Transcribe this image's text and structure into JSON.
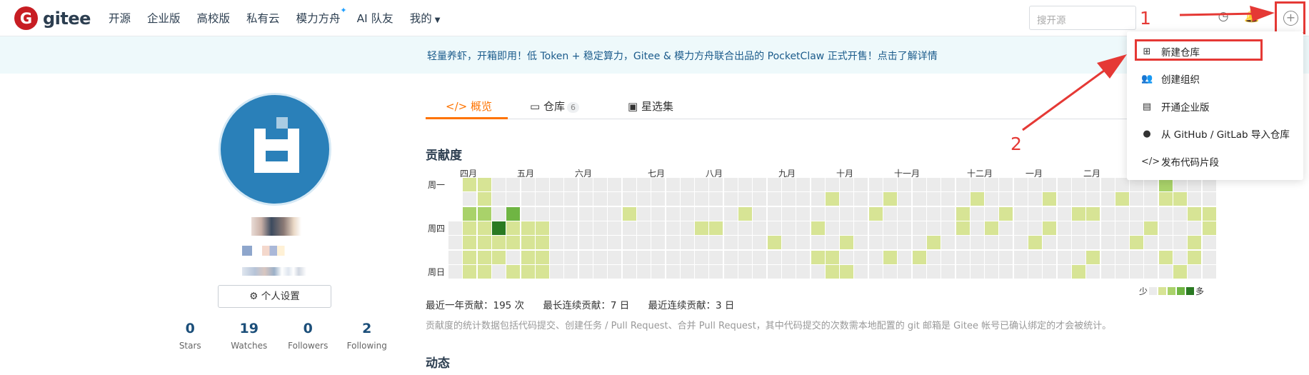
{
  "nav": {
    "logo_mark": "G",
    "logo_text": "gitee",
    "items": [
      "开源",
      "企业版",
      "高校版",
      "私有云",
      "模力方舟",
      "AI 队友",
      "我的"
    ],
    "search_placeholder": "搜开源"
  },
  "banner": "轻量养虾，开箱即用！低 Token + 稳定算力，Gitee & 模力方舟联合出品的 PocketClaw 正式开售！点击了解详情",
  "profile": {
    "settings_label": "个人设置",
    "stats": [
      {
        "num": "0",
        "label": "Stars"
      },
      {
        "num": "19",
        "label": "Watches"
      },
      {
        "num": "0",
        "label": "Followers"
      },
      {
        "num": "2",
        "label": "Following"
      }
    ]
  },
  "tabs": {
    "overview": "概览",
    "repos": "仓库",
    "repos_count": "6",
    "stars": "星选集"
  },
  "contrib": {
    "title": "贡献度",
    "months": [
      "四月",
      "五月",
      "六月",
      "七月",
      "八月",
      "九月",
      "十月",
      "十一月",
      "十二月",
      "一月",
      "二月"
    ],
    "days": [
      "周一",
      "周四",
      "周日"
    ],
    "legend_less": "少",
    "legend_more": "多",
    "legend_colors": [
      "#ebebeb",
      "#d7e495",
      "#a9d26a",
      "#6fb543",
      "#2a7a22"
    ],
    "summary": {
      "year": "最近一年贡献：195 次",
      "longest": "最长连续贡献：7 日",
      "recent": "最近连续贡献：3 日"
    },
    "note": "贡献度的统计数据包括代码提交、创建任务 / Pull Request、合并 Pull Request，其中代码提交的次数需本地配置的 git 邮箱是 Gitee 帐号已确认绑定的才会被统计。"
  },
  "activity_title": "动态",
  "dropdown": {
    "items": [
      {
        "icon": "plus-square-icon",
        "label": "新建仓库"
      },
      {
        "icon": "users-icon",
        "label": "创建组织"
      },
      {
        "icon": "building-icon",
        "label": "开通企业版"
      },
      {
        "icon": "github-icon",
        "label": "从 GitHub / GitLab 导入仓库"
      },
      {
        "icon": "code-icon",
        "label": "发布代码片段"
      }
    ]
  },
  "annotations": {
    "one": "1",
    "two": "2"
  }
}
